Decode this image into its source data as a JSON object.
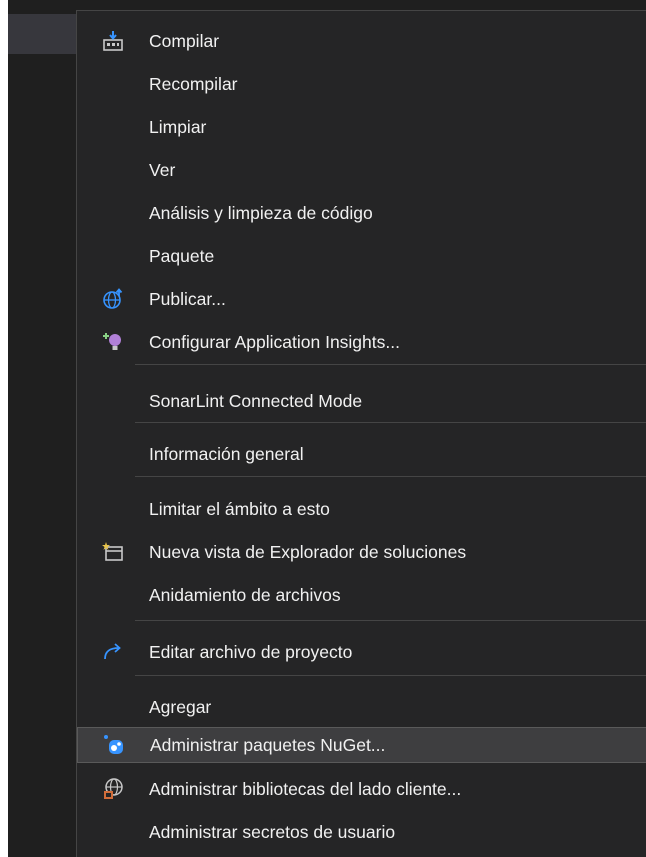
{
  "menu": {
    "items": [
      {
        "label": "Compilar",
        "icon": "build-icon"
      },
      {
        "label": "Recompilar"
      },
      {
        "label": "Limpiar"
      },
      {
        "label": "Ver"
      },
      {
        "label": "Análisis y limpieza de código"
      },
      {
        "label": "Paquete"
      },
      {
        "label": "Publicar...",
        "icon": "globe-publish-icon"
      },
      {
        "label": "Configurar Application Insights...",
        "icon": "insights-bulb-icon"
      },
      {
        "label": "SonarLint Connected Mode"
      },
      {
        "label": "Información general"
      },
      {
        "label": "Limitar el ámbito a esto"
      },
      {
        "label": "Nueva vista de Explorador de soluciones",
        "icon": "new-window-icon"
      },
      {
        "label": "Anidamiento de archivos"
      },
      {
        "label": "Editar archivo de proyecto",
        "icon": "edit-arrow-icon"
      },
      {
        "label": "Agregar"
      },
      {
        "label": "Administrar paquetes NuGet...",
        "icon": "nuget-icon",
        "highlighted": true
      },
      {
        "label": "Administrar bibliotecas del lado cliente...",
        "icon": "client-library-icon"
      },
      {
        "label": "Administrar secretos de usuario"
      }
    ]
  },
  "colors": {
    "menu_background": "#252526",
    "highlight": "#3e3e40",
    "text": "#f1f1f1",
    "separator": "#454545"
  }
}
